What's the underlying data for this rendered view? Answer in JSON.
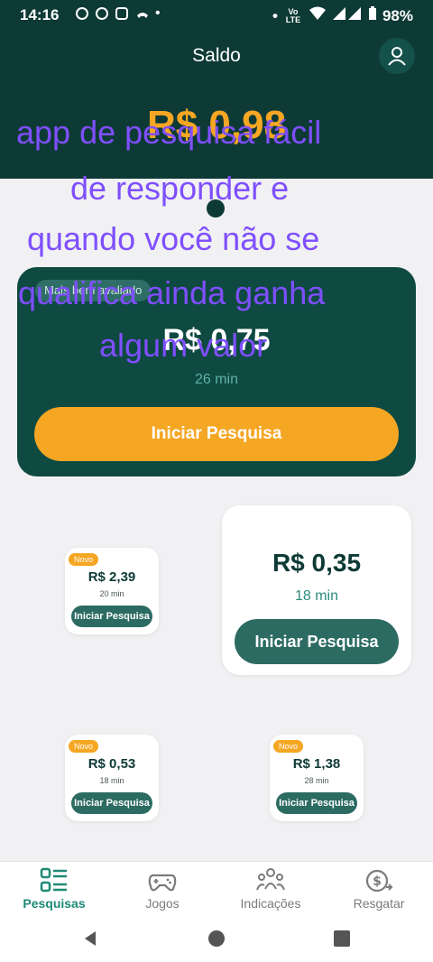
{
  "status_bar": {
    "time": "14:16",
    "network": "Vo LTE",
    "battery": "98%",
    "bullet_left": "•",
    "bullet_right": "•"
  },
  "header": {
    "title": "Saldo",
    "balance": "R$ 0,98"
  },
  "overlay_caption": {
    "lines": [
      "app de pesquisa fácil",
      "de responder e",
      "quando você não se",
      "qualifica ainda ganha",
      "algum valor"
    ]
  },
  "featured_survey": {
    "badge": "Mais bem avaliado",
    "amount": "R$ 0,75",
    "duration": "26 min",
    "button_label": "Iniciar Pesquisa"
  },
  "surveys": [
    {
      "badge": "Novo",
      "amount": "R$ 2,39",
      "duration": "20 min",
      "button_label": "Iniciar Pesquisa"
    },
    {
      "badge": "",
      "amount": "R$ 0,35",
      "duration": "18 min",
      "button_label": "Iniciar Pesquisa"
    },
    {
      "badge": "Novo",
      "amount": "R$ 0,53",
      "duration": "18 min",
      "button_label": "Iniciar Pesquisa"
    },
    {
      "badge": "Novo",
      "amount": "R$ 1,38",
      "duration": "28 min",
      "button_label": "Iniciar Pesquisa"
    }
  ],
  "bottom_nav": {
    "items": [
      {
        "label": "Pesquisas",
        "icon": "list-icon",
        "active": true
      },
      {
        "label": "Jogos",
        "icon": "gamepad-icon",
        "active": false
      },
      {
        "label": "Indicações",
        "icon": "users-icon",
        "active": false
      },
      {
        "label": "Resgatar",
        "icon": "cash-out-icon",
        "active": false
      }
    ]
  },
  "colors": {
    "primary_dark": "#0e3a36",
    "accent_orange": "#f5a623",
    "button_teal": "#2c6b62",
    "active_nav": "#1e8a76",
    "overlay_text": "#7f4fff"
  }
}
